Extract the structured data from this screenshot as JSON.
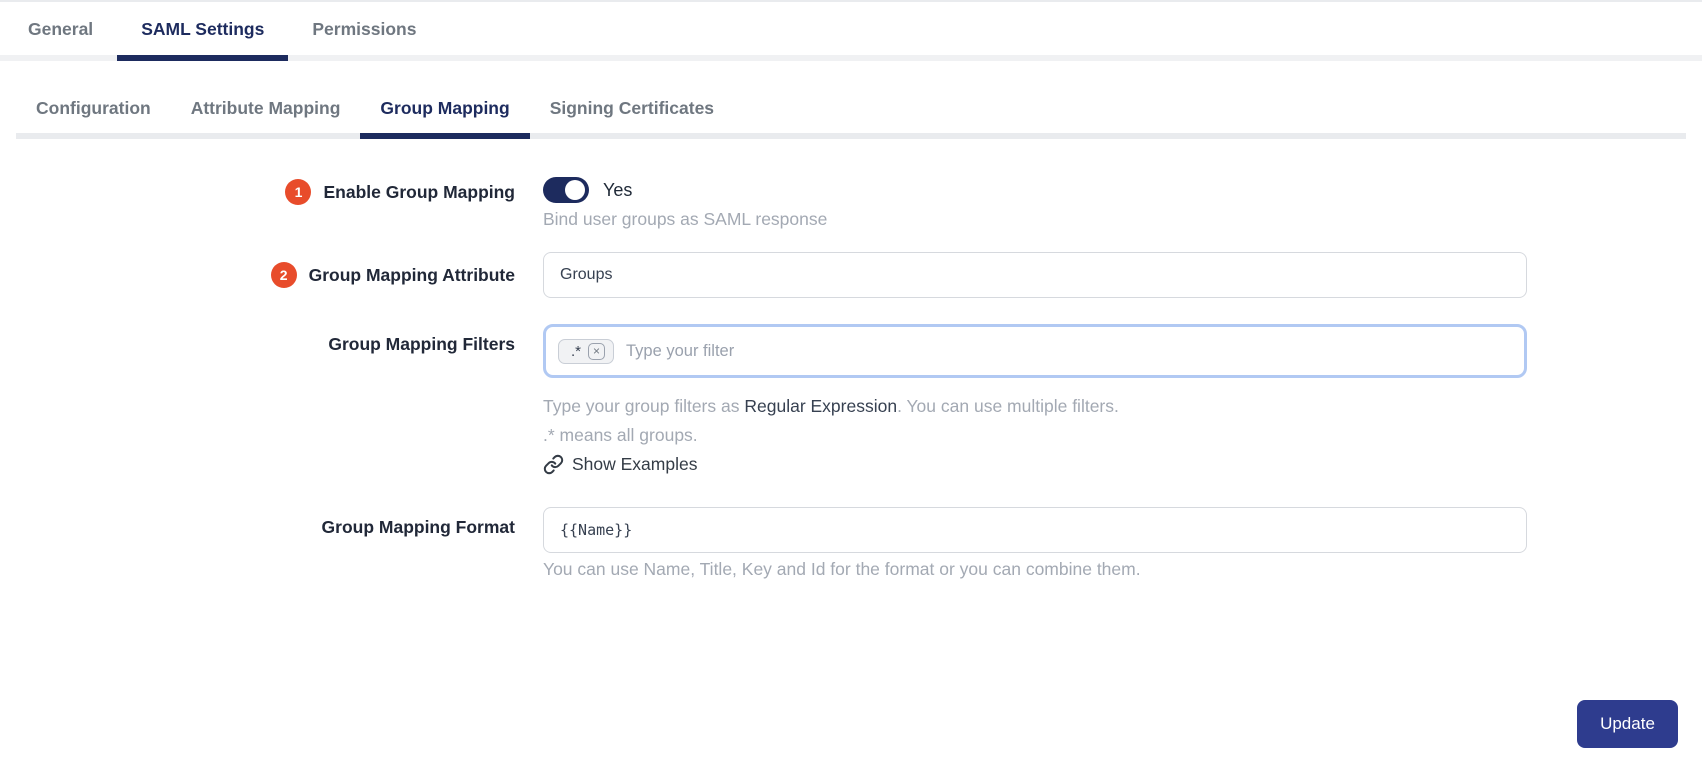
{
  "top_tabs": {
    "items": [
      {
        "label": "General",
        "active": false
      },
      {
        "label": "SAML Settings",
        "active": true
      },
      {
        "label": "Permissions",
        "active": false
      }
    ]
  },
  "sub_tabs": {
    "items": [
      {
        "label": "Configuration",
        "active": false
      },
      {
        "label": "Attribute Mapping",
        "active": false
      },
      {
        "label": "Group Mapping",
        "active": true
      },
      {
        "label": "Signing Certificates",
        "active": false
      }
    ]
  },
  "form": {
    "enable_group_mapping": {
      "badge": "1",
      "label": "Enable Group Mapping",
      "toggle_state": "on",
      "toggle_label": "Yes",
      "help": "Bind user groups as SAML response"
    },
    "group_mapping_attribute": {
      "badge": "2",
      "label": "Group Mapping Attribute",
      "value": "Groups"
    },
    "group_mapping_filters": {
      "label": "Group Mapping Filters",
      "tag_value": ".*",
      "tag_remove_glyph": "×",
      "placeholder": "Type your filter",
      "help_prefix": "Type your group filters as ",
      "help_strong": "Regular Expression",
      "help_suffix": ". You can use multiple filters.",
      "help_line2": ".* means all groups.",
      "examples_link": "Show Examples"
    },
    "group_mapping_format": {
      "label": "Group Mapping Format",
      "value": "{{Name}}",
      "help": "You can use Name, Title, Key and Id for the format or you can combine them."
    }
  },
  "actions": {
    "update_label": "Update"
  },
  "colors": {
    "navy": "#1d2b5e",
    "button_blue": "#2e3c8e",
    "badge_red": "#e84c2b",
    "focus_ring": "#b1c9f3",
    "help_gray": "#a3a9b3"
  }
}
